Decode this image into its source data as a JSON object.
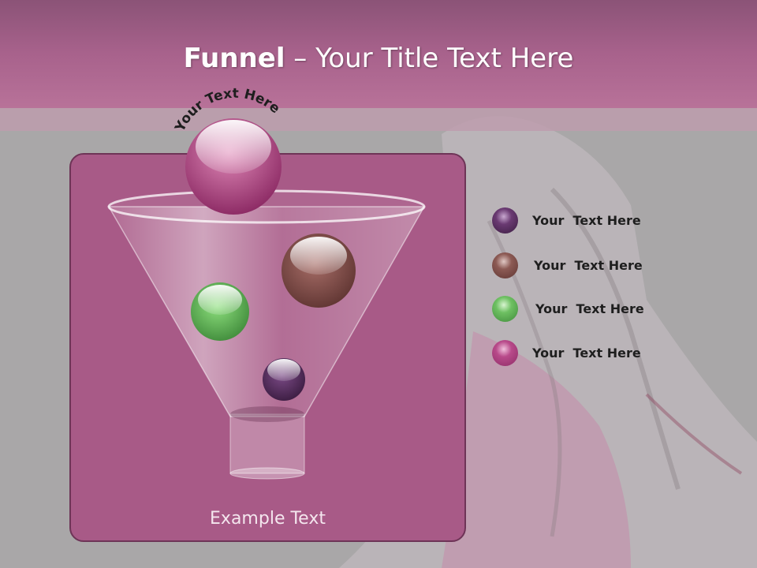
{
  "slide": {
    "title_bold": "Funnel",
    "title_rest": " – Your Title Text Here",
    "arc_text": "Your Text Here",
    "footer_text": "Example Text"
  },
  "legend": [
    {
      "label": "Your  Text Here",
      "color": "#4f2a55"
    },
    {
      "label": "Your  Text Here",
      "color": "#7a4a46"
    },
    {
      "label": "Your  Text Here",
      "color": "#4e9a48"
    },
    {
      "label": "Your  Text Here",
      "color": "#a23a78"
    }
  ],
  "colors": {
    "title_band": "#a8628c",
    "panel": "#a85a87",
    "top_ball": "#b04a86"
  }
}
